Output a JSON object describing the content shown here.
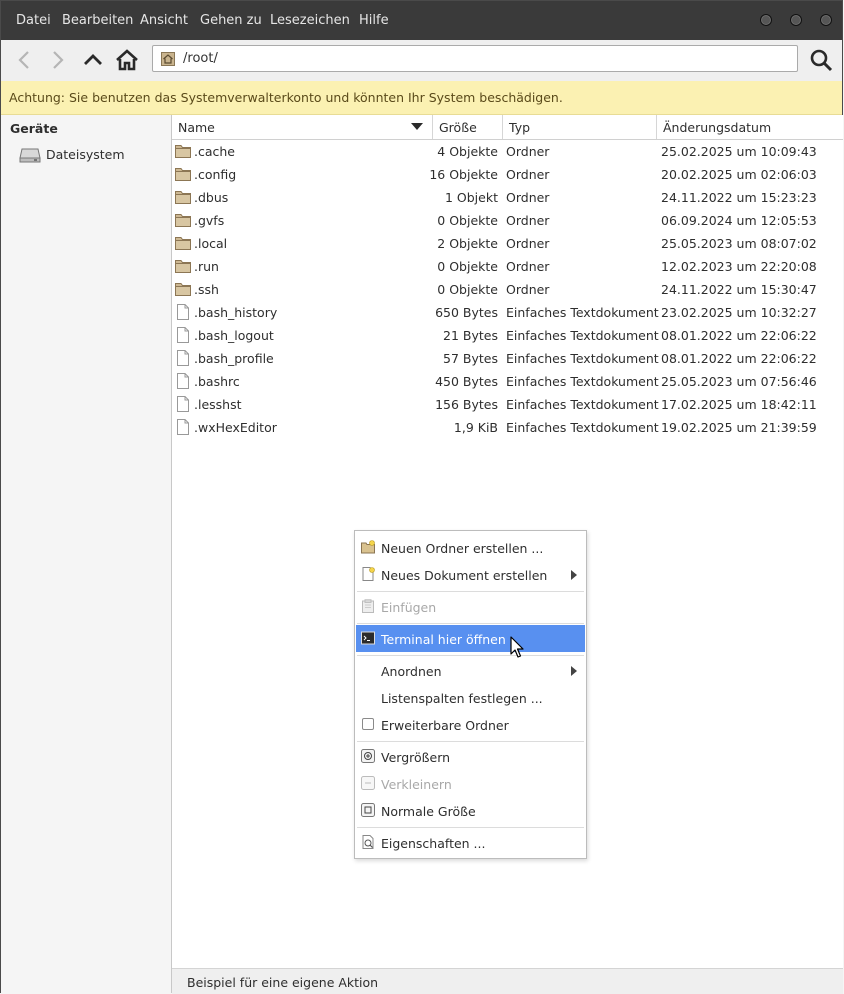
{
  "menubar": {
    "items": [
      "Datei",
      "Bearbeiten",
      "Ansicht",
      "Gehen zu",
      "Lesezeichen",
      "Hilfe"
    ]
  },
  "toolbar": {
    "location_path": "/root/"
  },
  "warning": {
    "text": "Achtung: Sie benutzen das Systemverwalterkonto und könnten Ihr System beschädigen."
  },
  "sidebar": {
    "heading": "Geräte",
    "items": [
      {
        "label": "Dateisystem"
      }
    ]
  },
  "columns": {
    "name": "Name",
    "size": "Größe",
    "type": "Typ",
    "date": "Änderungsdatum"
  },
  "files": [
    {
      "name": ".cache",
      "size": "4 Objekte",
      "type": "Ordner",
      "date": "25.02.2025 um 10:09:43",
      "kind": "folder"
    },
    {
      "name": ".config",
      "size": "16 Objekte",
      "type": "Ordner",
      "date": "20.02.2025 um 02:06:03",
      "kind": "folder"
    },
    {
      "name": ".dbus",
      "size": "1 Objekt",
      "type": "Ordner",
      "date": "24.11.2022 um 15:23:23",
      "kind": "folder"
    },
    {
      "name": ".gvfs",
      "size": "0 Objekte",
      "type": "Ordner",
      "date": "06.09.2024 um 12:05:53",
      "kind": "folder"
    },
    {
      "name": ".local",
      "size": "2 Objekte",
      "type": "Ordner",
      "date": "25.05.2023 um 08:07:02",
      "kind": "folder"
    },
    {
      "name": ".run",
      "size": "0 Objekte",
      "type": "Ordner",
      "date": "12.02.2023 um 22:20:08",
      "kind": "folder"
    },
    {
      "name": ".ssh",
      "size": "0 Objekte",
      "type": "Ordner",
      "date": "24.11.2022 um 15:30:47",
      "kind": "folder"
    },
    {
      "name": ".bash_history",
      "size": "650 Bytes",
      "type": "Einfaches Textdokument",
      "date": "23.02.2025 um 10:32:27",
      "kind": "file"
    },
    {
      "name": ".bash_logout",
      "size": "21 Bytes",
      "type": "Einfaches Textdokument",
      "date": "08.01.2022 um 22:06:22",
      "kind": "file"
    },
    {
      "name": ".bash_profile",
      "size": "57 Bytes",
      "type": "Einfaches Textdokument",
      "date": "08.01.2022 um 22:06:22",
      "kind": "file"
    },
    {
      "name": ".bashrc",
      "size": "450 Bytes",
      "type": "Einfaches Textdokument",
      "date": "25.05.2023 um 07:56:46",
      "kind": "file"
    },
    {
      "name": ".lesshst",
      "size": "156 Bytes",
      "type": "Einfaches Textdokument",
      "date": "17.02.2025 um 18:42:11",
      "kind": "file"
    },
    {
      "name": ".wxHexEditor",
      "size": "1,9 KiB",
      "type": "Einfaches Textdokument",
      "date": "19.02.2025 um 21:39:59",
      "kind": "file"
    }
  ],
  "context_menu": {
    "new_folder": "Neuen Ordner erstellen ...",
    "new_document": "Neues Dokument erstellen",
    "paste": "Einfügen",
    "terminal": "Terminal hier öffnen",
    "arrange": "Anordnen",
    "list_columns": "Listenspalten festlegen ...",
    "expandable_folders": "Erweiterbare Ordner",
    "zoom_in": "Vergrößern",
    "zoom_out": "Verkleinern",
    "normal_size": "Normale Größe",
    "properties": "Eigenschaften ..."
  },
  "statusbar": {
    "text": "Beispiel für eine eigene Aktion"
  },
  "colors": {
    "menubar_bg": "#3a3a3a",
    "warning_bg": "#fbf1b2",
    "highlight": "#5890f0"
  }
}
